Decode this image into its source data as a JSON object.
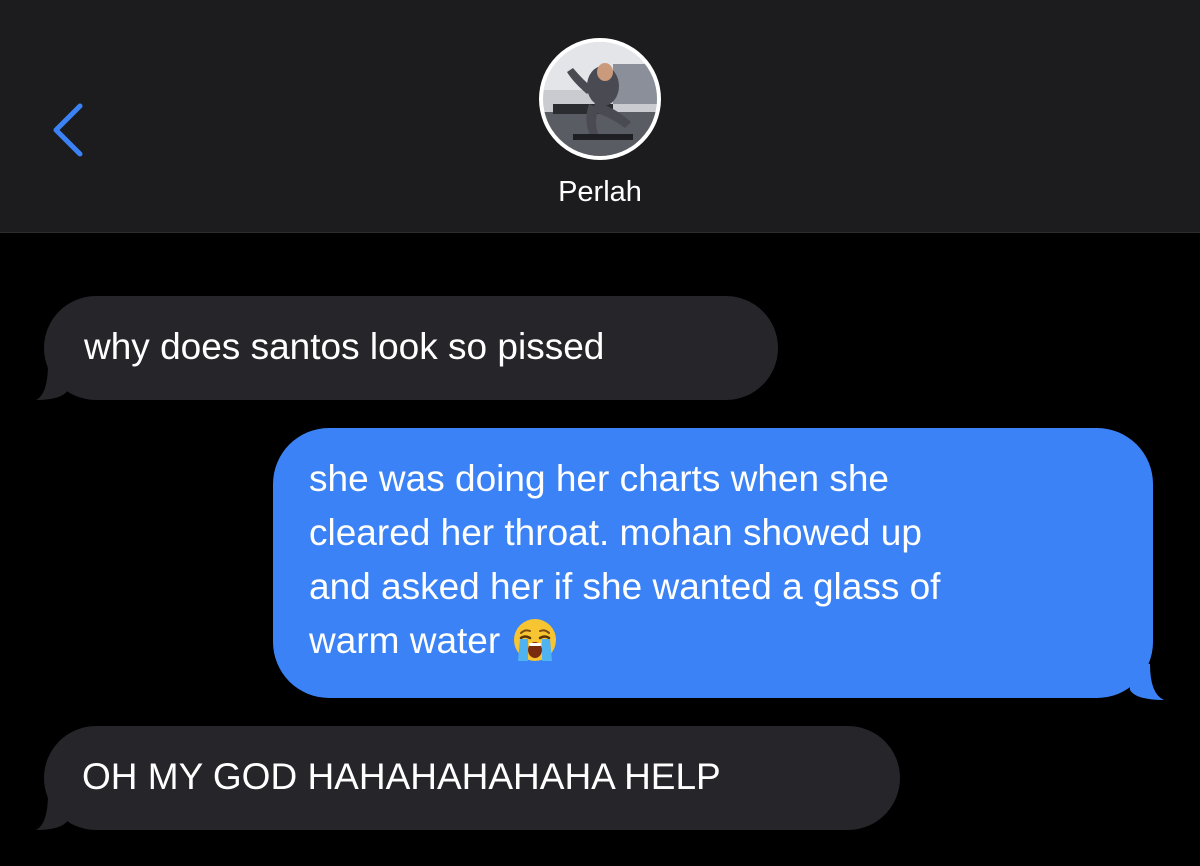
{
  "header": {
    "contact_name": "Perlah",
    "back_icon": "chevron-left-icon",
    "accent_color": "#3b82f6"
  },
  "messages": [
    {
      "direction": "incoming",
      "lines": [
        "why does santos look so pissed"
      ]
    },
    {
      "direction": "outgoing",
      "lines": [
        "she was doing her charts when she",
        "cleared her throat. mohan showed up",
        "and asked her if she wanted a glass of",
        "warm water"
      ],
      "emoji": "loudly-crying-face-icon"
    },
    {
      "direction": "incoming",
      "lines": [
        "OH MY GOD HAHAHAHAHAHA HELP"
      ]
    }
  ],
  "colors": {
    "header_bg": "#1c1c1e",
    "incoming_bubble": "#26252a",
    "outgoing_bubble": "#3b82f6",
    "background": "#000000"
  }
}
